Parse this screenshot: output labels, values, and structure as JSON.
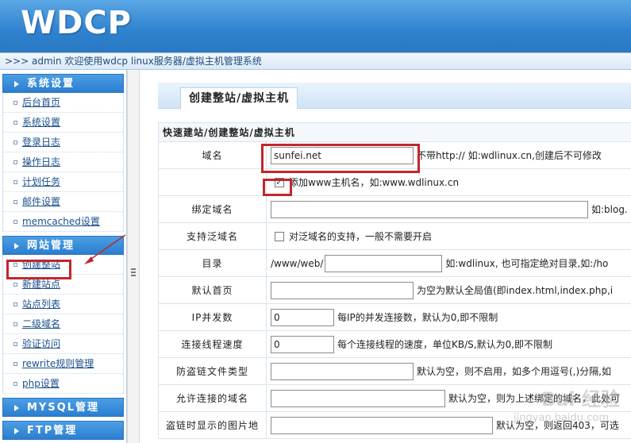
{
  "header": {
    "logo": "WDCP"
  },
  "topbar": {
    "text": ">>> admin 欢迎使用wdcp linux服务器/虚拟主机管理系统"
  },
  "sidebar": {
    "sections": [
      {
        "title": "系统设置",
        "items": [
          "后台首页",
          "系统设置",
          "登录日志",
          "操作日志",
          "计划任务",
          "邮件设置",
          "memcached设置"
        ]
      },
      {
        "title": "网站管理",
        "items": [
          "创建整站",
          "新建站点",
          "站点列表",
          "二级域名",
          "验证访问",
          "rewrite规则管理",
          "php设置"
        ]
      },
      {
        "title": "MYSQL管理",
        "items": []
      },
      {
        "title": "FTP管理",
        "items": []
      }
    ]
  },
  "main": {
    "tab": "创建整站/虚拟主机",
    "form_title": "快速建站/创建整站/虚拟主机",
    "rows": {
      "domain": {
        "label": "域名",
        "value": "sunfei.net",
        "hint": "不带http:// 如:wdlinux.cn,创建后不可修改"
      },
      "www": {
        "hint": "添加www主机名，如:www.wdlinux.cn"
      },
      "bind": {
        "label": "绑定域名",
        "value": "",
        "hint": "如:blog."
      },
      "wildcard": {
        "label": "支持泛域名",
        "hint": "对泛域名的支持，一般不需要开启"
      },
      "dir": {
        "label": "目录",
        "prefix": "/www/web/",
        "value": "",
        "hint": "如:wdlinux, 也可指定绝对目录,如:/ho"
      },
      "index": {
        "label": "默认首页",
        "value": "",
        "hint": "为空为默认全局值(即index.html,index.php,i"
      },
      "ip": {
        "label": "IP并发数",
        "value": "0",
        "hint": "每IP的并发连接数，默认为0,即不限制"
      },
      "speed": {
        "label": "连接线程速度",
        "value": "0",
        "hint": "每个连接线程的速度，单位KB/S,默认为0,即不限制"
      },
      "hotlink": {
        "label": "防盗链文件类型",
        "value": "",
        "hint": "默认为空，则不启用，如多个用逗号(,)分隔,如"
      },
      "allowed": {
        "label": "允许连接的域名",
        "value": "",
        "hint": "默认为空，则为上述绑定的域名，此处可"
      },
      "image": {
        "label": "盗链时显示的图片地",
        "value": "",
        "hint": "默认为空，则返回403，可选"
      }
    }
  },
  "watermark": {
    "text": "Bai 经验",
    "sub": "jingyan.baidu.com"
  }
}
